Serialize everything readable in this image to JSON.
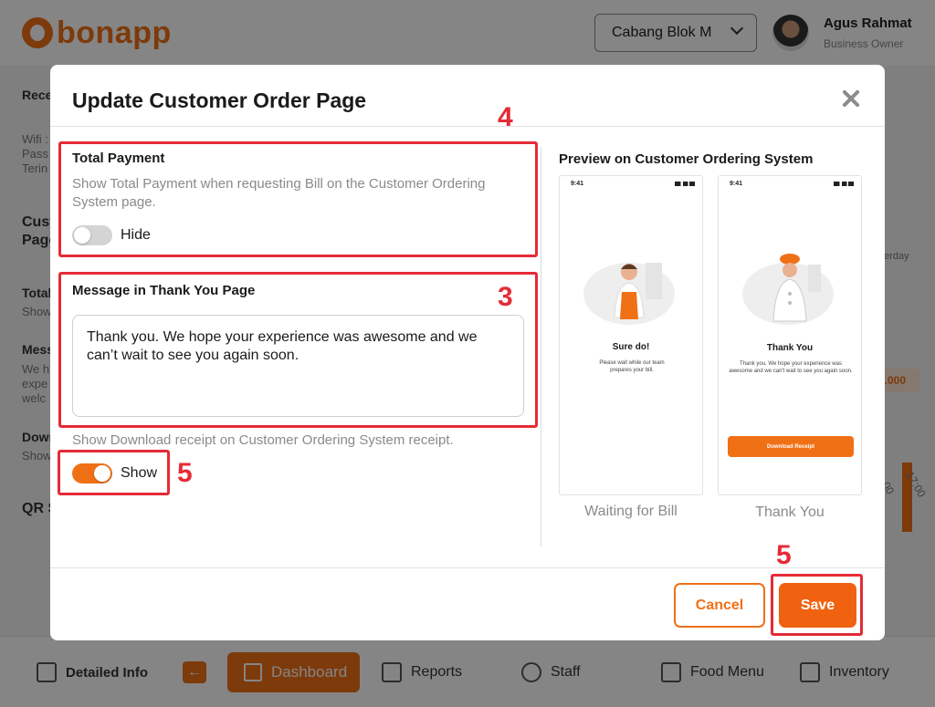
{
  "app": {
    "logo_text": "bonapp",
    "branch": "Cabang Blok M",
    "user_name": "Agus Rahmat",
    "user_role": "Business Owner"
  },
  "background": {
    "left_items": [
      "Rece",
      "Wifi :",
      "Pass",
      "Terin",
      "Cust",
      "Page",
      "Total",
      "Show",
      "Mess",
      "We h",
      "expe",
      "welc",
      "Down",
      "Show",
      "QR S"
    ],
    "right_items": [
      "terday",
      "0.000",
      "00",
      "17:00"
    ]
  },
  "nav": {
    "detailed_info": "Detailed Info",
    "dashboard": "Dashboard",
    "reports": "Reports",
    "staff": "Staff",
    "food_menu": "Food Menu",
    "inventory": "Inventory",
    "back_glyph": "←"
  },
  "modal": {
    "title": "Update Customer Order Page",
    "total_payment": {
      "title": "Total Payment",
      "description": "Show Total Payment when requesting Bill on the Customer Ordering System page.",
      "toggle_on": false,
      "toggle_label": "Hide"
    },
    "thank_you": {
      "title": "Message in Thank You Page",
      "message": "Thank you. We hope your experience was awesome and we can’t wait to see you again soon."
    },
    "download_receipt": {
      "description": "Show Download receipt on Customer Ordering System receipt.",
      "toggle_on": true,
      "toggle_label": "Show"
    },
    "preview": {
      "title": "Preview on Customer Ordering System",
      "phone_time": "9:41",
      "waiting": {
        "heading": "Sure do!",
        "sub": "Please wait while our team prepares your bill.",
        "caption": "Waiting for Bill"
      },
      "thanks": {
        "heading": "Thank You",
        "sub": "Thank you. We hope your experience was awesome and we can't wait to see you again soon.",
        "button": "Download Receipt",
        "caption": "Thank You"
      }
    },
    "cancel_label": "Cancel",
    "save_label": "Save"
  },
  "annotations": [
    "4",
    "3",
    "5",
    "5"
  ],
  "colors": {
    "accent": "#f07016",
    "annotation": "#e52b36"
  }
}
